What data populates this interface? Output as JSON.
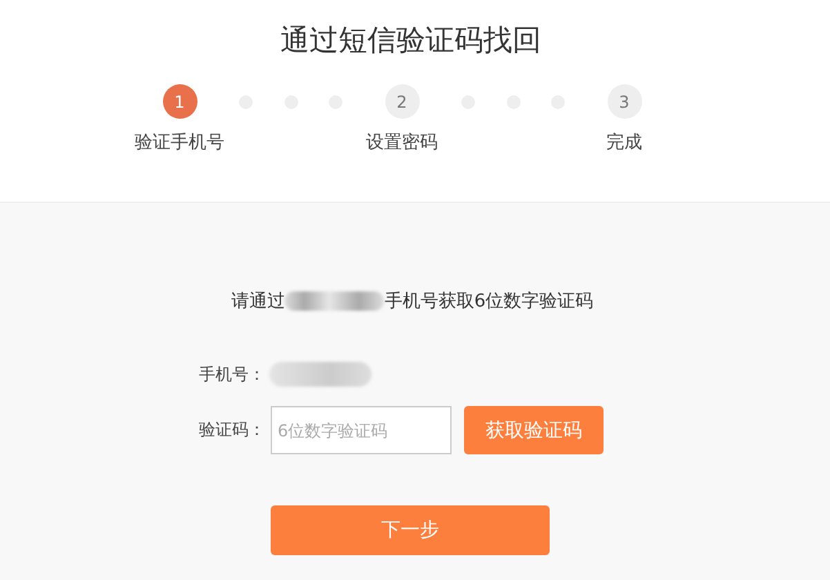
{
  "title": "通过短信验证码找回",
  "steps": [
    {
      "number": "1",
      "label": "验证手机号",
      "selected": true
    },
    {
      "number": "2",
      "label": "设置密码",
      "selected": false
    },
    {
      "number": "3",
      "label": "完成",
      "selected": false
    }
  ],
  "instruction": {
    "before": "请通过",
    "after": "手机号获取6位数字验证码"
  },
  "phone": {
    "label": "手机号："
  },
  "code": {
    "label": "验证码：",
    "placeholder": "6位数字验证码"
  },
  "send_button": "获取验证码",
  "next_button": "下一步"
}
